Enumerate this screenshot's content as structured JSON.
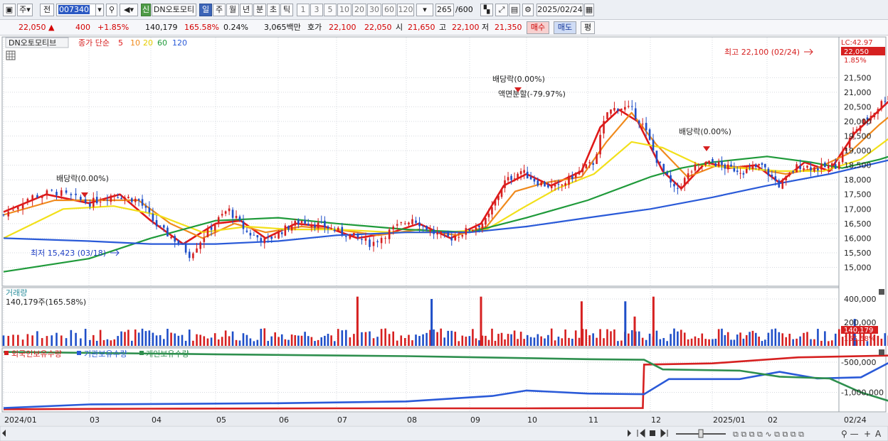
{
  "toolbar": {
    "period_type": "주",
    "prev_label": "전",
    "stock_code": "007340",
    "stock_name": "DN오토모티",
    "badge_new": "신",
    "periods": [
      "일",
      "주",
      "월",
      "년",
      "분",
      "초",
      "틱"
    ],
    "active_period": "일",
    "intervals": [
      "1",
      "3",
      "5",
      "10",
      "20",
      "30",
      "60",
      "120"
    ],
    "count": "265",
    "count_total": "/600",
    "date": "2025/02/24"
  },
  "quote": {
    "price": "22,050",
    "change": "400",
    "change_pct": "+1.85%",
    "volume": "140,179",
    "volume_ratio": "165.58%",
    "turnover_pct": "0.24%",
    "amount": "3,065백만",
    "hoga_label": "호가",
    "ask": "22,100",
    "bid": "22,050",
    "open_label": "시",
    "open": "21,650",
    "high_label": "고",
    "high": "22,100",
    "low_label": "저",
    "low": "21,350",
    "buy_button": "매수",
    "sell_button": "매도",
    "eval_button": "평"
  },
  "price_panel": {
    "stock_name": "DN오토모티브",
    "ma_title": "종가 단순",
    "ma_periods": [
      "5",
      "10",
      "20",
      "60",
      "120"
    ],
    "lc_label": "LC:42.97",
    "current_price_tag": "22,050",
    "current_pct_tag": "1.85%",
    "annotations": {
      "high": "최고 22,100 (02/24)",
      "low": "최저 15,423 (03/18)",
      "dividend_1": "배당락(0.00%)",
      "dividend_2": "배당락(0.00%)",
      "dividend_3": "배당락(0.00%)",
      "split": "액면분할(-79.97%)"
    }
  },
  "volume_panel": {
    "title": "거래량",
    "value_text": "140,179주(165.58%)",
    "tag_value": "140,179",
    "tag_pct": "165.58%"
  },
  "holder_panel": {
    "legend": [
      "외국인보유수량",
      "기관보유수량",
      "개인보유수량"
    ]
  },
  "x_axis": {
    "labels": [
      "2024/01",
      "03",
      "04",
      "05",
      "06",
      "07",
      "08",
      "09",
      "10",
      "11",
      "12",
      "2025/01",
      "02"
    ],
    "current_date_tag": "02/24"
  },
  "colors": {
    "up": "#d62020",
    "down": "#1f4fc8",
    "ma5": "#e01818",
    "ma10": "#f08a1c",
    "ma20": "#f2e01a",
    "ma60": "#1f9a3a",
    "ma120": "#2a5ad8",
    "foreign": "#d62020",
    "institution": "#2a5ad8",
    "individual": "#2e8f4e"
  },
  "chart_data": {
    "type": "line",
    "x_range": [
      "2024/01",
      "2025/02/24"
    ],
    "price_axis": {
      "ticks": [
        15000,
        15500,
        16000,
        16500,
        17000,
        17500,
        18000,
        18500,
        19000,
        19500,
        20000,
        20500,
        21000,
        21500
      ],
      "ylim": [
        14550,
        22700
      ]
    },
    "volume_axis": {
      "ticks": [
        200000,
        400000
      ]
    },
    "holder_axis": {
      "ticks": [
        -500000,
        -1000000
      ]
    },
    "series_close": [
      {
        "m": 0.0,
        "v": 16800
      },
      {
        "m": 0.3,
        "v": 17400
      },
      {
        "m": 0.6,
        "v": 17600
      },
      {
        "m": 1.0,
        "v": 17200
      },
      {
        "m": 1.4,
        "v": 17500
      },
      {
        "m": 1.8,
        "v": 17300
      },
      {
        "m": 2.1,
        "v": 16400
      },
      {
        "m": 2.4,
        "v": 15900
      },
      {
        "m": 2.6,
        "v": 15430
      },
      {
        "m": 2.9,
        "v": 16300
      },
      {
        "m": 3.2,
        "v": 17000
      },
      {
        "m": 3.5,
        "v": 16200
      },
      {
        "m": 3.8,
        "v": 15900
      },
      {
        "m": 4.1,
        "v": 16300
      },
      {
        "m": 4.4,
        "v": 16600
      },
      {
        "m": 4.8,
        "v": 16400
      },
      {
        "m": 5.2,
        "v": 16100
      },
      {
        "m": 5.5,
        "v": 15800
      },
      {
        "m": 5.8,
        "v": 16300
      },
      {
        "m": 6.1,
        "v": 16700
      },
      {
        "m": 6.4,
        "v": 16200
      },
      {
        "m": 6.7,
        "v": 16000
      },
      {
        "m": 7.0,
        "v": 16300
      },
      {
        "m": 7.3,
        "v": 16600
      },
      {
        "m": 7.6,
        "v": 17900
      },
      {
        "m": 7.9,
        "v": 18300
      },
      {
        "m": 8.2,
        "v": 17900
      },
      {
        "m": 8.5,
        "v": 17700
      },
      {
        "m": 8.8,
        "v": 18200
      },
      {
        "m": 9.1,
        "v": 18600
      },
      {
        "m": 9.3,
        "v": 20300
      },
      {
        "m": 9.5,
        "v": 20500
      },
      {
        "m": 9.7,
        "v": 20400
      },
      {
        "m": 9.9,
        "v": 19800
      },
      {
        "m": 10.1,
        "v": 18700
      },
      {
        "m": 10.4,
        "v": 17600
      },
      {
        "m": 10.7,
        "v": 18400
      },
      {
        "m": 11.0,
        "v": 18600
      },
      {
        "m": 11.3,
        "v": 18400
      },
      {
        "m": 11.6,
        "v": 18300
      },
      {
        "m": 11.9,
        "v": 18500
      },
      {
        "m": 12.2,
        "v": 17800
      },
      {
        "m": 12.5,
        "v": 18500
      },
      {
        "m": 12.8,
        "v": 18400
      },
      {
        "m": 13.1,
        "v": 18500
      },
      {
        "m": 13.4,
        "v": 19700
      },
      {
        "m": 13.7,
        "v": 20300
      },
      {
        "m": 14.0,
        "v": 21100
      },
      {
        "m": 14.3,
        "v": 21200
      },
      {
        "m": 14.6,
        "v": 20900
      },
      {
        "m": 14.8,
        "v": 20700
      },
      {
        "m": 14.9,
        "v": 22050
      }
    ],
    "series": [
      {
        "name": "5",
        "points": [
          {
            "m": 0.0,
            "v": 16900
          },
          {
            "m": 0.5,
            "v": 17500
          },
          {
            "m": 1.0,
            "v": 17200
          },
          {
            "m": 1.5,
            "v": 17500
          },
          {
            "m": 2.0,
            "v": 16600
          },
          {
            "m": 2.5,
            "v": 15800
          },
          {
            "m": 3.0,
            "v": 16500
          },
          {
            "m": 3.4,
            "v": 16600
          },
          {
            "m": 3.8,
            "v": 16000
          },
          {
            "m": 4.3,
            "v": 16500
          },
          {
            "m": 4.8,
            "v": 16400
          },
          {
            "m": 5.3,
            "v": 16000
          },
          {
            "m": 5.8,
            "v": 16200
          },
          {
            "m": 6.2,
            "v": 16500
          },
          {
            "m": 6.7,
            "v": 16000
          },
          {
            "m": 7.2,
            "v": 16500
          },
          {
            "m": 7.6,
            "v": 17800
          },
          {
            "m": 8.0,
            "v": 18200
          },
          {
            "m": 8.4,
            "v": 17800
          },
          {
            "m": 8.9,
            "v": 18300
          },
          {
            "m": 9.2,
            "v": 19800
          },
          {
            "m": 9.5,
            "v": 20400
          },
          {
            "m": 9.8,
            "v": 20000
          },
          {
            "m": 10.2,
            "v": 18300
          },
          {
            "m": 10.5,
            "v": 17700
          },
          {
            "m": 10.9,
            "v": 18600
          },
          {
            "m": 11.3,
            "v": 18400
          },
          {
            "m": 11.8,
            "v": 18500
          },
          {
            "m": 12.2,
            "v": 17900
          },
          {
            "m": 12.6,
            "v": 18600
          },
          {
            "m": 13.0,
            "v": 18300
          },
          {
            "m": 13.4,
            "v": 19600
          },
          {
            "m": 13.8,
            "v": 20400
          },
          {
            "m": 14.1,
            "v": 21000
          },
          {
            "m": 14.4,
            "v": 21200
          },
          {
            "m": 14.7,
            "v": 20700
          },
          {
            "m": 14.9,
            "v": 21300
          }
        ]
      },
      {
        "name": "10",
        "points": [
          {
            "m": 0.0,
            "v": 16800
          },
          {
            "m": 0.6,
            "v": 17300
          },
          {
            "m": 1.2,
            "v": 17300
          },
          {
            "m": 1.8,
            "v": 17300
          },
          {
            "m": 2.3,
            "v": 16500
          },
          {
            "m": 2.8,
            "v": 16000
          },
          {
            "m": 3.3,
            "v": 16500
          },
          {
            "m": 3.8,
            "v": 16200
          },
          {
            "m": 4.4,
            "v": 16400
          },
          {
            "m": 5.0,
            "v": 16300
          },
          {
            "m": 5.6,
            "v": 16100
          },
          {
            "m": 6.2,
            "v": 16300
          },
          {
            "m": 6.8,
            "v": 16100
          },
          {
            "m": 7.3,
            "v": 16400
          },
          {
            "m": 7.8,
            "v": 17600
          },
          {
            "m": 8.3,
            "v": 17900
          },
          {
            "m": 8.9,
            "v": 18100
          },
          {
            "m": 9.3,
            "v": 19300
          },
          {
            "m": 9.7,
            "v": 20300
          },
          {
            "m": 10.1,
            "v": 19200
          },
          {
            "m": 10.6,
            "v": 18100
          },
          {
            "m": 11.1,
            "v": 18500
          },
          {
            "m": 11.7,
            "v": 18400
          },
          {
            "m": 12.3,
            "v": 18200
          },
          {
            "m": 12.8,
            "v": 18400
          },
          {
            "m": 13.3,
            "v": 18900
          },
          {
            "m": 13.8,
            "v": 19900
          },
          {
            "m": 14.2,
            "v": 20600
          },
          {
            "m": 14.6,
            "v": 20900
          },
          {
            "m": 14.9,
            "v": 21100
          }
        ]
      },
      {
        "name": "20",
        "points": [
          {
            "m": 0.0,
            "v": 16000
          },
          {
            "m": 0.7,
            "v": 17000
          },
          {
            "m": 1.4,
            "v": 17100
          },
          {
            "m": 2.1,
            "v": 16800
          },
          {
            "m": 2.8,
            "v": 16200
          },
          {
            "m": 3.5,
            "v": 16400
          },
          {
            "m": 4.2,
            "v": 16300
          },
          {
            "m": 5.0,
            "v": 16300
          },
          {
            "m": 5.8,
            "v": 16200
          },
          {
            "m": 6.6,
            "v": 16200
          },
          {
            "m": 7.3,
            "v": 16300
          },
          {
            "m": 7.9,
            "v": 17000
          },
          {
            "m": 8.5,
            "v": 17700
          },
          {
            "m": 9.1,
            "v": 18200
          },
          {
            "m": 9.7,
            "v": 19300
          },
          {
            "m": 10.2,
            "v": 19100
          },
          {
            "m": 10.8,
            "v": 18500
          },
          {
            "m": 11.5,
            "v": 18400
          },
          {
            "m": 12.2,
            "v": 18300
          },
          {
            "m": 12.9,
            "v": 18300
          },
          {
            "m": 13.5,
            "v": 18700
          },
          {
            "m": 14.0,
            "v": 19500
          },
          {
            "m": 14.5,
            "v": 20400
          },
          {
            "m": 14.9,
            "v": 20900
          }
        ]
      },
      {
        "name": "60",
        "points": [
          {
            "m": 0.0,
            "v": 14850
          },
          {
            "m": 1.0,
            "v": 15300
          },
          {
            "m": 2.0,
            "v": 16000
          },
          {
            "m": 3.0,
            "v": 16600
          },
          {
            "m": 4.0,
            "v": 16700
          },
          {
            "m": 5.0,
            "v": 16500
          },
          {
            "m": 6.0,
            "v": 16300
          },
          {
            "m": 7.0,
            "v": 16200
          },
          {
            "m": 8.0,
            "v": 16700
          },
          {
            "m": 9.0,
            "v": 17300
          },
          {
            "m": 10.0,
            "v": 18100
          },
          {
            "m": 10.5,
            "v": 18400
          },
          {
            "m": 11.0,
            "v": 18600
          },
          {
            "m": 12.0,
            "v": 18800
          },
          {
            "m": 12.7,
            "v": 18600
          },
          {
            "m": 13.2,
            "v": 18400
          },
          {
            "m": 13.8,
            "v": 18700
          },
          {
            "m": 14.4,
            "v": 19100
          },
          {
            "m": 14.9,
            "v": 19450
          }
        ]
      },
      {
        "name": "120",
        "points": [
          {
            "m": 0.0,
            "v": 16000
          },
          {
            "m": 1.0,
            "v": 15900
          },
          {
            "m": 2.0,
            "v": 15800
          },
          {
            "m": 3.0,
            "v": 15800
          },
          {
            "m": 4.0,
            "v": 15900
          },
          {
            "m": 5.0,
            "v": 16100
          },
          {
            "m": 6.0,
            "v": 16200
          },
          {
            "m": 7.0,
            "v": 16200
          },
          {
            "m": 8.0,
            "v": 16400
          },
          {
            "m": 9.0,
            "v": 16700
          },
          {
            "m": 10.0,
            "v": 17000
          },
          {
            "m": 11.0,
            "v": 17400
          },
          {
            "m": 12.0,
            "v": 17800
          },
          {
            "m": 13.0,
            "v": 18200
          },
          {
            "m": 14.0,
            "v": 18700
          },
          {
            "m": 14.9,
            "v": 19050
          }
        ]
      }
    ],
    "holders": [
      {
        "name": "외국인보유수량",
        "points": [
          {
            "m": 0.0,
            "v": -1280000
          },
          {
            "m": 2.0,
            "v": -1270000
          },
          {
            "m": 5.0,
            "v": -1265000
          },
          {
            "m": 8.0,
            "v": -1265000
          },
          {
            "m": 9.88,
            "v": -1260000
          },
          {
            "m": 9.9,
            "v": -540000
          },
          {
            "m": 11.0,
            "v": -520000
          },
          {
            "m": 12.5,
            "v": -420000
          },
          {
            "m": 14.0,
            "v": -390000
          },
          {
            "m": 14.9,
            "v": -380000
          }
        ]
      },
      {
        "name": "기관보유수량",
        "points": [
          {
            "m": 0.0,
            "v": -1260000
          },
          {
            "m": 1.0,
            "v": -1200000
          },
          {
            "m": 4.0,
            "v": -1180000
          },
          {
            "m": 6.0,
            "v": -1150000
          },
          {
            "m": 7.4,
            "v": -1060000
          },
          {
            "m": 8.0,
            "v": -970000
          },
          {
            "m": 9.0,
            "v": -1020000
          },
          {
            "m": 9.9,
            "v": -1030000
          },
          {
            "m": 10.3,
            "v": -780000
          },
          {
            "m": 11.5,
            "v": -780000
          },
          {
            "m": 12.2,
            "v": -660000
          },
          {
            "m": 12.8,
            "v": -770000
          },
          {
            "m": 13.5,
            "v": -750000
          },
          {
            "m": 14.0,
            "v": -480000
          },
          {
            "m": 14.4,
            "v": -390000
          },
          {
            "m": 14.9,
            "v": -430000
          }
        ]
      },
      {
        "name": "개인보유수량",
        "points": [
          {
            "m": 0.0,
            "v": -330000
          },
          {
            "m": 3.0,
            "v": -370000
          },
          {
            "m": 6.0,
            "v": -400000
          },
          {
            "m": 9.0,
            "v": -450000
          },
          {
            "m": 9.9,
            "v": -460000
          },
          {
            "m": 10.2,
            "v": -620000
          },
          {
            "m": 11.5,
            "v": -640000
          },
          {
            "m": 12.2,
            "v": -740000
          },
          {
            "m": 13.0,
            "v": -770000
          },
          {
            "m": 13.5,
            "v": -1000000
          },
          {
            "m": 14.0,
            "v": -1160000
          },
          {
            "m": 14.9,
            "v": -1270000
          }
        ]
      }
    ],
    "volume_spikes": [
      {
        "m": 5.3,
        "v": 420000
      },
      {
        "m": 6.4,
        "v": 400000
      },
      {
        "m": 7.2,
        "v": 420000
      },
      {
        "m": 8.9,
        "v": 380000
      },
      {
        "m": 9.6,
        "v": 380000
      },
      {
        "m": 9.75,
        "v": 250000
      },
      {
        "m": 10.05,
        "v": 420000
      },
      {
        "m": 13.4,
        "v": 230000
      },
      {
        "m": 14.0,
        "v": 160000
      },
      {
        "m": 14.9,
        "v": 140179
      }
    ]
  }
}
